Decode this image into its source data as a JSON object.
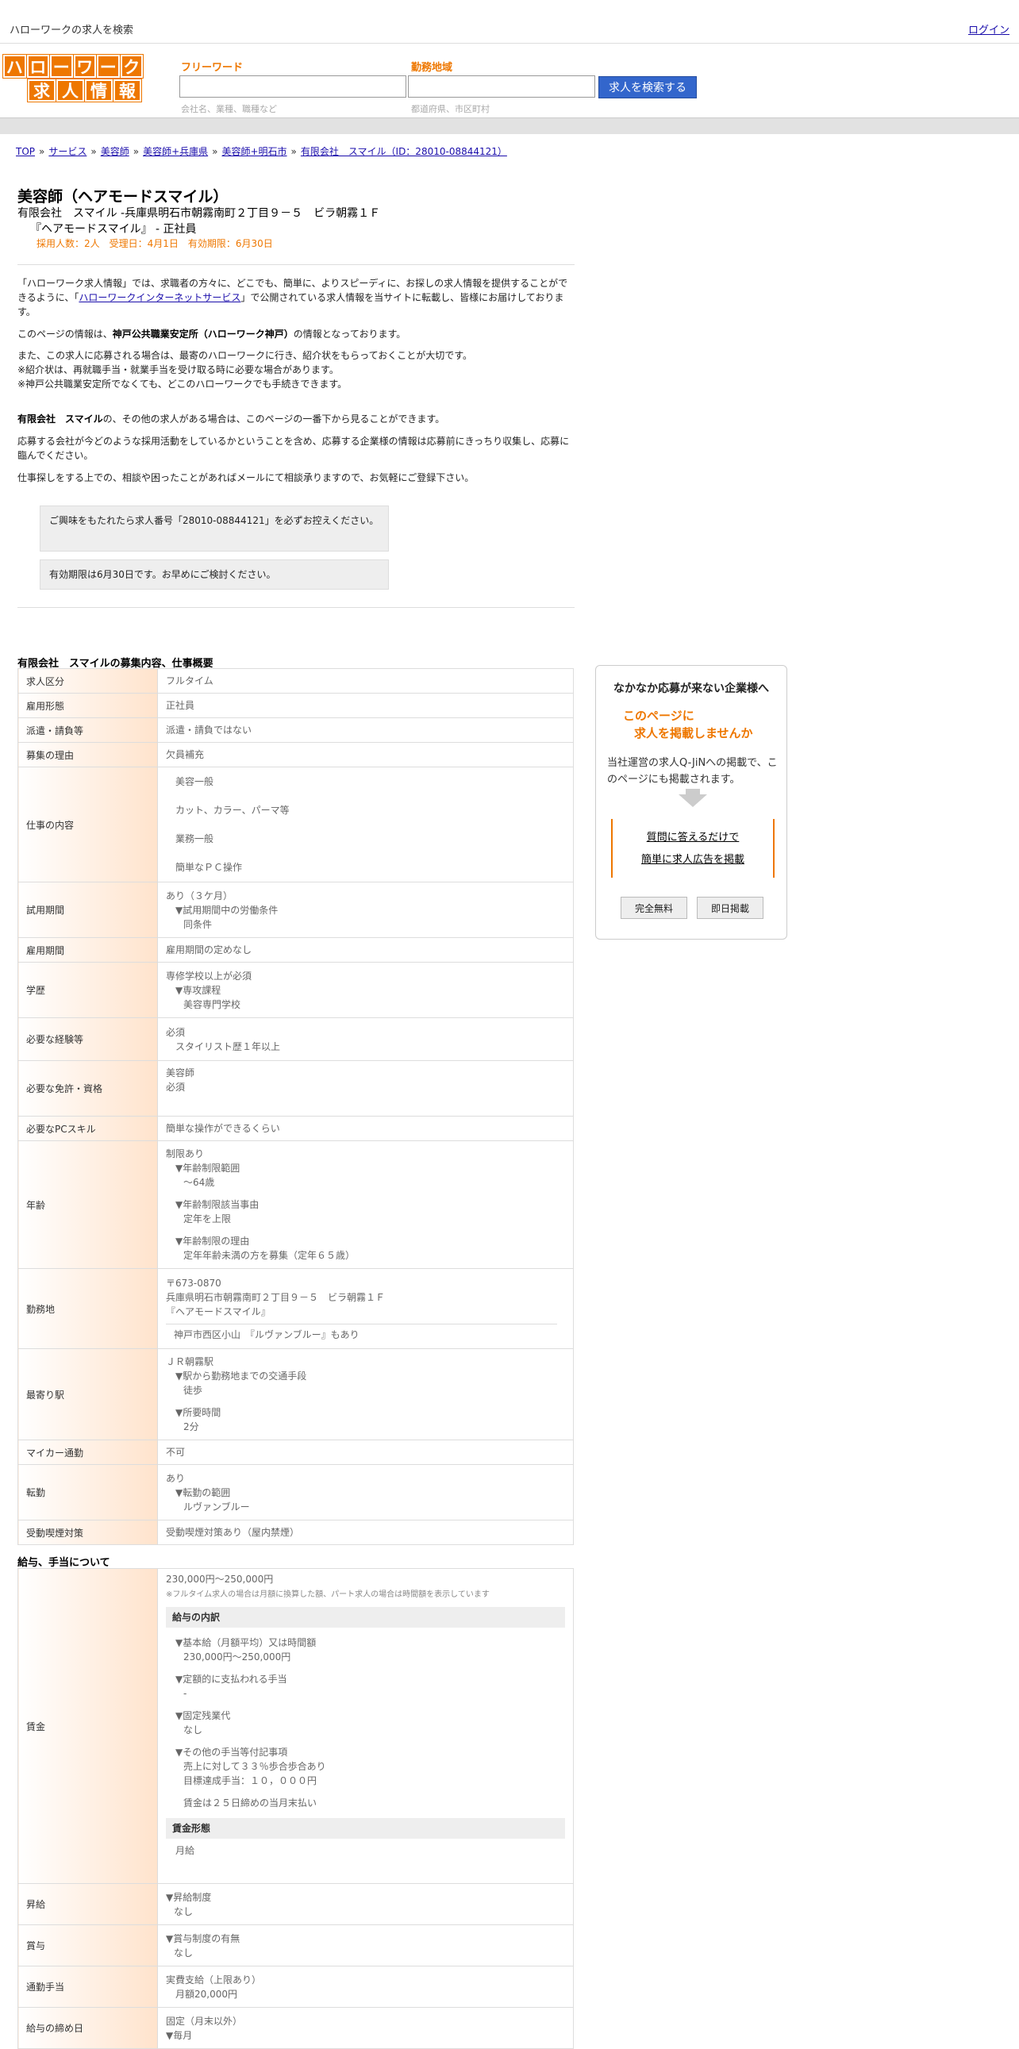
{
  "topbar": {
    "site_title": "ハローワークの求人を検索",
    "login": "ログイン"
  },
  "header": {
    "logo_row1": [
      "ハ",
      "ロ",
      "ー",
      "ワ",
      "ー",
      "ク"
    ],
    "logo_row2": [
      "求",
      "人",
      "情",
      "報"
    ],
    "freeword_label": "フリーワード",
    "freeword_hint": "会社名、業種、職種など",
    "area_label": "勤務地域",
    "area_hint": "都道府県、市区町村",
    "search_button": "求人を検索する"
  },
  "breadcrumb": [
    "TOP",
    "サービス",
    "美容師",
    "美容師+兵庫県",
    "美容師+明石市",
    "有限会社　スマイル（ID：28010-08844121）"
  ],
  "job": {
    "title": "美容師（ヘアモードスマイル）",
    "company_line": "有限会社　スマイル -兵庫県明石市朝霧南町２丁目９－５　ビラ朝霧１Ｆ",
    "store_line": "『ヘアモードスマイル』 - 正社員",
    "meta": "採用人数：2人　受理日：4月1日　有効期限：6月30日"
  },
  "intro": {
    "p1_a": "「ハローワーク求人情報」では、求職者の方々に、どこでも、簡単に、よりスピーディに、お探しの求人情報を提供することができるように、「",
    "p1_link": "ハローワークインターネットサービス",
    "p1_b": "」で公開されている求人情報を当サイトに転載し、皆様にお届けしております。",
    "p2_a": "このページの情報は、",
    "p2_bold": "神戸公共職業安定所（ハローワーク神戸）",
    "p2_b": "の情報となっております。",
    "p3_l1": "また、この求人に応募される場合は、最寄のハローワークに行き、紹介状をもらっておくことが大切です。",
    "p3_l2": "※紹介状は、再就職手当・就業手当を受け取る時に必要な場合があります。",
    "p3_l3": "※神戸公共職業安定所でなくても、どこのハローワークでも手続きできます。",
    "p4_bold": "有限会社　スマイル",
    "p4_b": "の、その他の求人がある場合は、このページの一番下から見ることができます。",
    "p5": "応募する会社が今どのような採用活動をしているかということを含め、応募する企業様の情報は応募前にきっちり収集し、応募に臨んでください。",
    "p6": "仕事探しをする上での、相談や困ったことがあればメールにて相談承りますので、お気軽にご登録下さい。",
    "notice1": "ご興味をもたれたら求人番号「28010-08844121」を必ずお控えください。",
    "notice2": "有効期限は6月30日です。お早めにご検討ください。"
  },
  "overview": {
    "title": "有限会社　スマイルの募集内容、仕事概要",
    "rows": {
      "kubun": {
        "k": "求人区分",
        "v": "フルタイム"
      },
      "keitai": {
        "k": "雇用形態",
        "v": "正社員"
      },
      "haken": {
        "k": "派遣・請負等",
        "v": "派遣・請負ではない"
      },
      "riyu": {
        "k": "募集の理由",
        "v": "欠員補充"
      },
      "naiyo": {
        "k": "仕事の内容",
        "l1": "美容一般",
        "l2": "カット、カラー、パーマ等",
        "l3": "業務一般",
        "l4": "簡単なＰＣ操作"
      },
      "shiyo": {
        "k": "試用期間",
        "l1": "あり（３ケ月）",
        "l2": "▼試用期間中の労働条件",
        "l3": "同条件"
      },
      "kikan": {
        "k": "雇用期間",
        "v": "雇用期間の定めなし"
      },
      "gakureki": {
        "k": "学歴",
        "l1": "専修学校以上が必須",
        "l2": "▼専攻課程",
        "l3": "美容専門学校"
      },
      "keiken": {
        "k": "必要な経験等",
        "l1": "必須",
        "l2": "スタイリスト歴１年以上"
      },
      "menkyo": {
        "k": "必要な免許・資格",
        "l1": "美容師",
        "l2": "必須"
      },
      "pc": {
        "k": "必要なPCスキル",
        "v": "簡単な操作ができるくらい"
      },
      "nenrei": {
        "k": "年齢",
        "l1": "制限あり",
        "l2": "▼年齢制限範囲",
        "l3": "～64歳",
        "l4": "▼年齢制限該当事由",
        "l5": "定年を上限",
        "l6": "▼年齢制限の理由",
        "l7": "定年年齢未満の方を募集（定年６５歳）"
      },
      "kinmuchi": {
        "k": "勤務地",
        "l1": "〒673-0870",
        "l2": "兵庫県明石市朝霧南町２丁目９－５　ビラ朝霧１Ｆ",
        "l3": "『ヘアモードスマイル』",
        "l4": "神戸市西区小山　『ルヴァンブルー』もあり"
      },
      "eki": {
        "k": "最寄り駅",
        "l1": "ＪＲ朝霧駅",
        "l2": "▼駅から勤務地までの交通手段",
        "l3": "徒歩",
        "l4": "▼所要時間",
        "l5": "2分"
      },
      "mycar": {
        "k": "マイカー通勤",
        "v": "不可"
      },
      "tenkin": {
        "k": "転勤",
        "l1": "あり",
        "l2": "▼転勤の範囲",
        "l3": "ルヴァンブルー"
      },
      "kitsuen": {
        "k": "受動喫煙対策",
        "v": "受動喫煙対策あり（屋内禁煙）"
      }
    }
  },
  "salary": {
    "title": "給与、手当について",
    "chingin": {
      "k": "賃金",
      "amount": "230,000円〜250,000円",
      "note": "※フルタイム求人の場合は月額に換算した額、パート求人の場合は時間額を表示しています",
      "breakdown_head": "給与の内訳",
      "b1": "▼基本給（月額平均）又は時間額",
      "b2": "230,000円〜250,000円",
      "b3": "▼定額的に支払われる手当",
      "b4": "-",
      "b5": "▼固定残業代",
      "b6": "なし",
      "b7": "▼その他の手当等付記事項",
      "b8": "売上に対して３３％歩合歩合あり",
      "b9": "目標達成手当：１０，０００円",
      "b10": "賃金は２５日締めの当月末払い",
      "form_head": "賃金形態",
      "form": "月給"
    },
    "shokyu": {
      "k": "昇給",
      "l1": "▼昇給制度",
      "l2": "なし"
    },
    "shoyo": {
      "k": "賞与",
      "l1": "▼賞与制度の有無",
      "l2": "なし"
    },
    "tsukin": {
      "k": "通勤手当",
      "l1": "実費支給（上限あり）",
      "l2": "月額20,000円"
    },
    "shimebi": {
      "k": "給与の締め日",
      "l1": "固定（月末以外）",
      "l2": "▼毎月"
    }
  },
  "sidebar": {
    "heading": "なかなか応募が来ない企業様へ",
    "catch1": "このページに",
    "catch2": "求人を掲載しませんか",
    "desc": "当社運営の求人Q-JiNへの掲載で、このページにも掲載されます。",
    "link1": "質問に答えるだけで",
    "link2": "簡単に求人広告を掲載",
    "btn1": "完全無料",
    "btn2": "即日掲載"
  }
}
